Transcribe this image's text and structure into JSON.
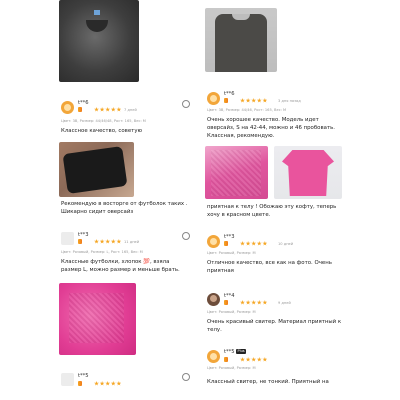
{
  "reviews": [
    {
      "user": "t**6",
      "date": "7 дней",
      "attrs": "Цвет: 3B, Размер: 44/46/48, Рост: 165, Вес: M",
      "text": "Классное качество, советую",
      "second_text": "Рекомендую в восторге от футболок таких . Шикарно сидит оверсайз"
    },
    {
      "user": "t**3",
      "date": "11 дней",
      "attrs": "Цвет: Розовый, Размер: L, Рост: 165, Вес: M",
      "text": "Классные футболки, хлопок 💯, взяла размер L, можно размер и меньше брать."
    },
    {
      "user": "t**5",
      "date": "",
      "attrs": "",
      "text": ""
    },
    {
      "user": "t**6",
      "date": "3 дня назад",
      "attrs": "Цвет: 3B, Размер: 44/46, Рост: 165, Вес: M",
      "text": "Очень хорошее качество. Модель идет оверсайз, S на 42-44, можно и 46 пробовать. Классная, рекомендую.",
      "second_text": "приятная к телу ! Обожаю эту кофту, теперь хочу в красном цвете."
    },
    {
      "user": "t**3",
      "date": "10 дней",
      "attrs": "Цвет: Розовый, Размер: M",
      "text": "Отличное качество, все как на фото. Очень приятная"
    },
    {
      "user": "t**4",
      "date": "9 дней",
      "attrs": "Цвет: Розовый, Размер: M",
      "text": "Очень красивый свитер. Материал приятный к телу."
    },
    {
      "user": "t**5",
      "date": "",
      "attrs": "Цвет: Розовый, Размер: M",
      "text": "Классный свитер, не тонкий. Приятный на"
    }
  ],
  "colors": {
    "star": "#f5a623",
    "badge_gradient": [
      "#f5a623",
      "#f07b1c"
    ],
    "pink": "#e8459a",
    "dark_gray": "#4a4a4a"
  },
  "icons": {
    "star": "star-icon",
    "level": "level-badge-icon",
    "avatar": "user-avatar"
  },
  "tags": {
    "plus": "Plus"
  }
}
